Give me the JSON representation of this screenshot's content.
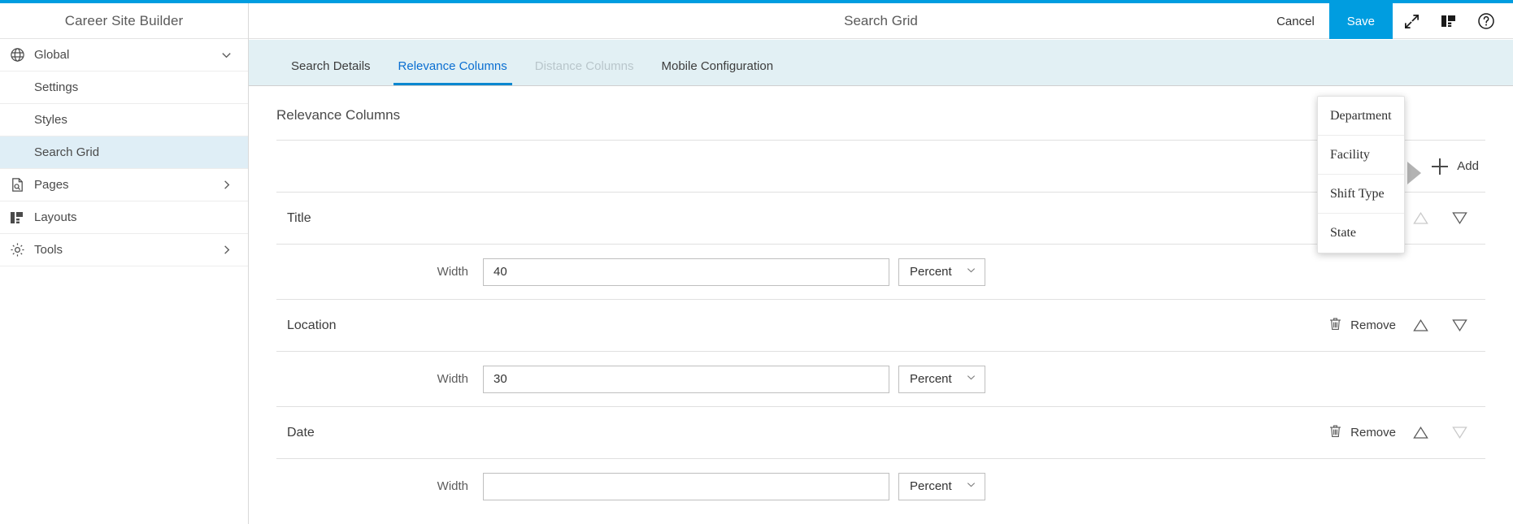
{
  "theme": {
    "accent": "#009de0",
    "tab_active": "#0a6ed1",
    "tabbar_bg": "#e2f0f4",
    "sidebar_selected_bg": "#dfeef6"
  },
  "sidebar": {
    "brand": "Career Site Builder",
    "items": [
      {
        "label": "Global",
        "icon": "globe-icon",
        "chevron": "chevron-down-icon",
        "level": "top",
        "selected": false
      },
      {
        "label": "Settings",
        "icon": "",
        "chevron": "",
        "level": "child",
        "selected": false
      },
      {
        "label": "Styles",
        "icon": "",
        "chevron": "",
        "level": "child",
        "selected": false
      },
      {
        "label": "Search Grid",
        "icon": "",
        "chevron": "",
        "level": "child",
        "selected": true
      },
      {
        "label": "Pages",
        "icon": "page-search-icon",
        "chevron": "chevron-right-icon",
        "level": "top",
        "selected": false
      },
      {
        "label": "Layouts",
        "icon": "layouts-icon",
        "chevron": "",
        "level": "top",
        "selected": false
      },
      {
        "label": "Tools",
        "icon": "gear-icon",
        "chevron": "chevron-right-icon",
        "level": "top",
        "selected": false
      }
    ]
  },
  "header": {
    "title": "Search Grid",
    "cancel_label": "Cancel",
    "save_label": "Save",
    "icons": [
      {
        "name": "expand-icon",
        "title": "Expand"
      },
      {
        "name": "layout-panel-icon",
        "title": "Layout"
      },
      {
        "name": "help-icon",
        "title": "Help"
      }
    ]
  },
  "tabs": [
    {
      "label": "Search Details",
      "state": "normal"
    },
    {
      "label": "Relevance Columns",
      "state": "active"
    },
    {
      "label": "Distance Columns",
      "state": "disabled"
    },
    {
      "label": "Mobile Configuration",
      "state": "normal"
    }
  ],
  "main": {
    "section_title": "Relevance Columns",
    "add_label": "Add",
    "remove_label": "Remove",
    "width_label": "Width",
    "columns": [
      {
        "name": "Title",
        "width_value": "40",
        "unit": "Percent",
        "removable": false,
        "move_up_enabled": false,
        "move_down_enabled": true
      },
      {
        "name": "Location",
        "width_value": "30",
        "unit": "Percent",
        "removable": true,
        "move_up_enabled": true,
        "move_down_enabled": true
      },
      {
        "name": "Date",
        "width_value": "",
        "unit": "Percent",
        "removable": true,
        "move_up_enabled": true,
        "move_down_enabled": false
      }
    ]
  },
  "popup_menu": {
    "items": [
      {
        "label": "Department"
      },
      {
        "label": "Facility"
      },
      {
        "label": "Shift Type"
      },
      {
        "label": "State"
      }
    ]
  }
}
